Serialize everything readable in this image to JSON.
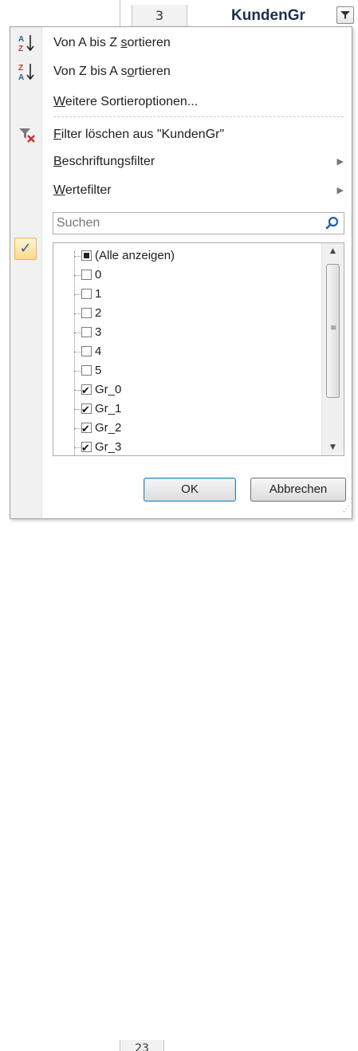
{
  "sheet": {
    "row_number_top": "3",
    "column_header": "KundenGr",
    "row_number_bottom": "23"
  },
  "menu": {
    "sort_az": {
      "prefix": "Von A bis Z ",
      "accel": "s",
      "suffix": "ortieren",
      "icon": "sort-az-icon"
    },
    "sort_za": {
      "prefix": "Von Z bis A s",
      "accel": "o",
      "suffix": "rtieren",
      "icon": "sort-za-icon"
    },
    "more_sort": {
      "prefix": "",
      "accel": "W",
      "suffix": "eitere Sortieroptionen...",
      "icon": ""
    },
    "clear_filter": {
      "prefix": "",
      "accel": "F",
      "suffix": "ilter löschen aus \"KundenGr\"",
      "icon": "clear-filter-icon"
    },
    "label_filter": {
      "prefix": "",
      "accel": "B",
      "suffix": "eschriftungsfilter",
      "icon": ""
    },
    "value_filter": {
      "prefix": "",
      "accel": "W",
      "suffix": "ertefilter",
      "icon": ""
    },
    "submenu_arrow": "▶"
  },
  "search": {
    "placeholder": "Suchen",
    "icon": "magnifier-icon"
  },
  "list": {
    "items": [
      {
        "label": "(Alle anzeigen)",
        "state": "indeterminate"
      },
      {
        "label": "0",
        "state": "unchecked"
      },
      {
        "label": "1",
        "state": "unchecked"
      },
      {
        "label": "2",
        "state": "unchecked"
      },
      {
        "label": "3",
        "state": "unchecked"
      },
      {
        "label": "4",
        "state": "unchecked"
      },
      {
        "label": "5",
        "state": "unchecked"
      },
      {
        "label": "Gr_0",
        "state": "checked"
      },
      {
        "label": "Gr_1",
        "state": "checked"
      },
      {
        "label": "Gr_2",
        "state": "checked"
      },
      {
        "label": "Gr_3",
        "state": "checked"
      }
    ]
  },
  "buttons": {
    "ok": "OK",
    "cancel": "Abbrechen"
  },
  "colors": {
    "accent": "#1f5fa8",
    "highlight": "#ffd98a"
  }
}
